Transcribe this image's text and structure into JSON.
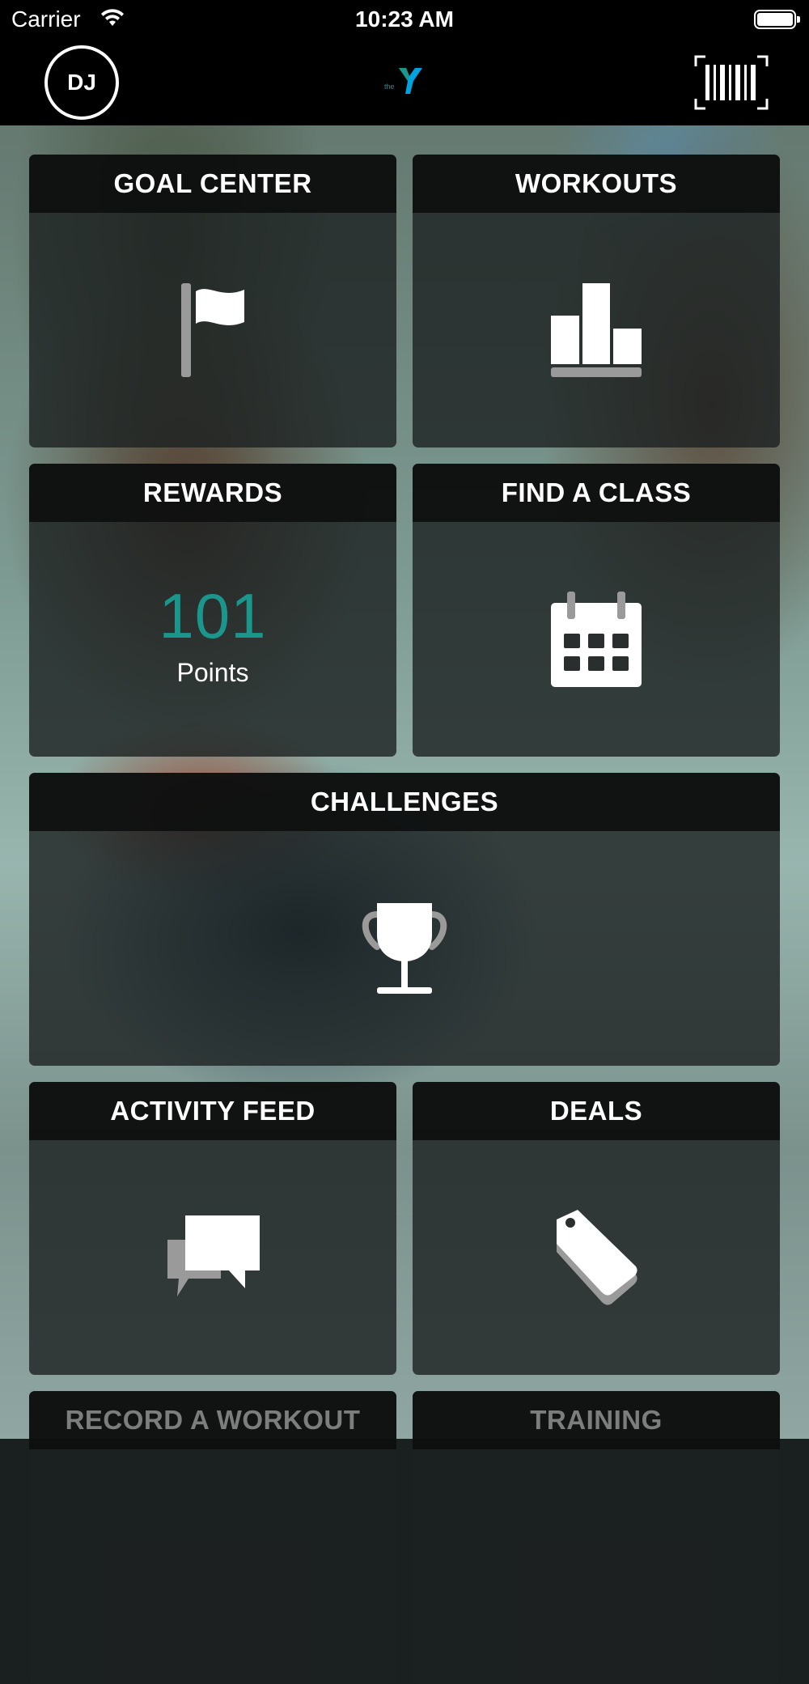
{
  "status_bar": {
    "carrier": "Carrier",
    "time": "10:23 AM"
  },
  "header": {
    "avatar_initials": "DJ",
    "logo_text": "the",
    "logo_colors": {
      "primary": "#00a2e0",
      "secondary": "#1a968d"
    },
    "barcode_icon": "barcode-scan-icon"
  },
  "tiles": [
    {
      "title": "GOAL CENTER",
      "icon": "flag-icon"
    },
    {
      "title": "WORKOUTS",
      "icon": "bar-chart-icon"
    },
    {
      "title": "REWARDS",
      "points_value": "101",
      "points_label": "Points"
    },
    {
      "title": "FIND A CLASS",
      "icon": "calendar-icon"
    },
    {
      "title": "CHALLENGES",
      "icon": "trophy-icon"
    },
    {
      "title": "ACTIVITY FEED",
      "icon": "chat-bubbles-icon"
    },
    {
      "title": "DEALS",
      "icon": "tag-icon"
    },
    {
      "title": "RECORD A WORKOUT"
    },
    {
      "title": "TRAINING"
    }
  ],
  "colors": {
    "accent": "#1a968d",
    "tile_header_bg": "#0c0e0e",
    "tile_body_bg": "#1c2020",
    "icon_gray": "#9a9a9a"
  }
}
